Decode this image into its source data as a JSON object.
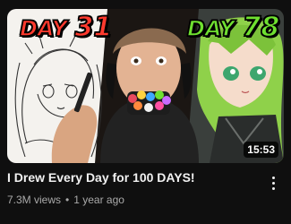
{
  "video": {
    "thumbnail": {
      "left_text_word": "DAY",
      "left_text_number": "31",
      "right_text_word": "DAY",
      "right_text_number": "78",
      "duration": "15:53",
      "accent_left": "#ff3a2e",
      "accent_right": "#6fe030"
    },
    "title": "I Drew Every Day for 100 DAYS!",
    "views": "7.3M views",
    "separator": "•",
    "age": "1 year ago"
  },
  "icons": {
    "more": "more-vert-icon"
  }
}
